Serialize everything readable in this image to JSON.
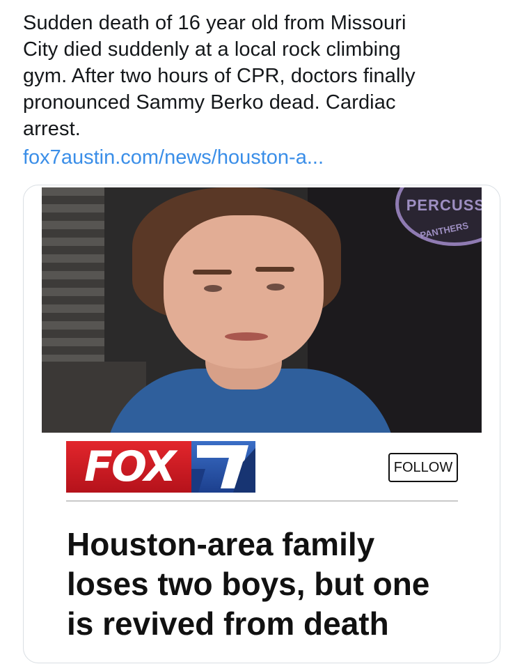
{
  "tweet": {
    "text_lines": [
      "Sudden death of 16 year old from Missouri",
      "City died suddenly at a local rock climbing",
      "gym. After two hours of CPR, doctors finally",
      "pronounced Sammy Berko dead. Cardiac",
      "arrest."
    ],
    "link": "fox7austin.com/news/houston-a..."
  },
  "card": {
    "image": {
      "badge_text": "PERCUSSIO",
      "badge_sub": "PANTHERS"
    },
    "brand": {
      "fox_text": "FOX",
      "channel": "7"
    },
    "follow_label": "FOLLOW",
    "headline_lines": [
      "Houston-area family",
      "loses two boys, but one",
      "is revived from death"
    ]
  },
  "colors": {
    "link": "#3a8ee8",
    "fox_red": "#d71f26",
    "fox_blue": "#2a57a8"
  }
}
